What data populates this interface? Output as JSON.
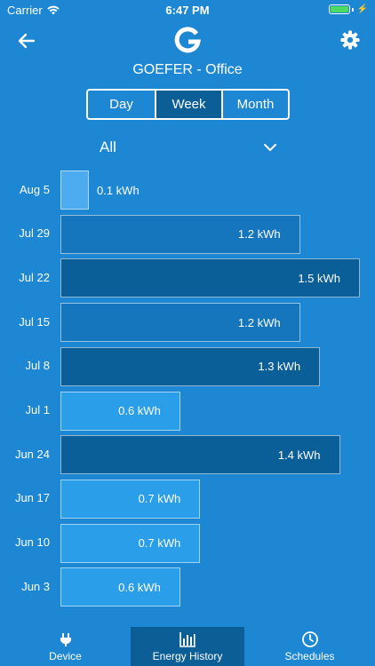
{
  "status_bar": {
    "carrier": "Carrier",
    "time": "6:47 PM"
  },
  "nav": {
    "back_icon": "back-arrow-icon",
    "logo_icon": "g-logo-icon",
    "settings_icon": "gear-icon"
  },
  "device_title": "GOEFER - Office",
  "segments": [
    {
      "label": "Day",
      "active": false
    },
    {
      "label": "Week",
      "active": true
    },
    {
      "label": "Month",
      "active": false
    }
  ],
  "filter": {
    "selected": "All",
    "icon": "chevron-down-icon"
  },
  "chart_data": {
    "type": "bar",
    "orientation": "horizontal",
    "unit": "kWh",
    "categories": [
      "Aug 5",
      "Jul 29",
      "Jul 22",
      "Jul 15",
      "Jul 8",
      "Jul 1",
      "Jun 24",
      "Jun 17",
      "Jun 10",
      "Jun 3"
    ],
    "values": [
      0.1,
      1.2,
      1.5,
      1.2,
      1.3,
      0.6,
      1.4,
      0.7,
      0.7,
      0.6
    ],
    "value_labels": [
      "0.1 kWh",
      "1.2 kWh",
      "1.5 kWh",
      "1.2 kWh",
      "1.3 kWh",
      "0.6 kWh",
      "1.4 kWh",
      "0.7 kWh",
      "0.7 kWh",
      "0.6 kWh"
    ],
    "xlim": [
      0,
      1.5
    ],
    "colors": {
      "light": "#2a9ee8",
      "mid": "#1676bd",
      "dark": "#0b5f98",
      "current": "#4dabef"
    }
  },
  "tabs": [
    {
      "label": "Device",
      "icon": "plug-icon",
      "active": false
    },
    {
      "label": "Energy History",
      "icon": "bar-chart-icon",
      "active": true
    },
    {
      "label": "Schedules",
      "icon": "clock-icon",
      "active": false
    }
  ]
}
